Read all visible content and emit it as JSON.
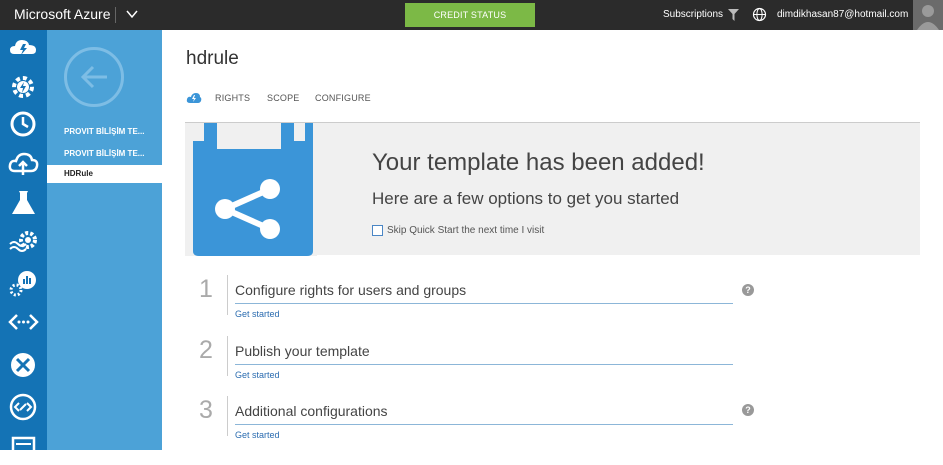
{
  "topbar": {
    "brand": "Microsoft Azure",
    "credit_status": "CREDIT STATUS",
    "subscriptions": "Subscriptions",
    "user_email": "dimdikhasan87@hotmail.com"
  },
  "rail": {
    "icons": [
      "cloud-services-icon",
      "gear-lightning-icon",
      "clock-icon",
      "cloud-upload-icon",
      "flask-icon",
      "gear-waves-icon",
      "chart-gear-icon",
      "code-brackets-icon",
      "tools-icon",
      "arrows-icon",
      "list-icon"
    ]
  },
  "subnav": {
    "items": [
      {
        "label": "PROVIT BİLİŞİM TE..."
      },
      {
        "label": "PROVIT BİLİŞİM TE..."
      },
      {
        "label": "HDRule"
      }
    ]
  },
  "main": {
    "title": "hdrule",
    "tabs": [
      {
        "label": "RIGHTS"
      },
      {
        "label": "SCOPE"
      },
      {
        "label": "CONFIGURE"
      }
    ],
    "banner": {
      "heading": "Your template has been added!",
      "subheading": "Here are a few options to get you started",
      "skip_label": "Skip Quick Start the next time I visit"
    },
    "steps": [
      {
        "number": "1",
        "title": "Configure rights for users and groups",
        "link": "Get started"
      },
      {
        "number": "2",
        "title": "Publish your template",
        "link": "Get started"
      },
      {
        "number": "3",
        "title": "Additional configurations",
        "link": "Get started"
      }
    ]
  },
  "colors": {
    "topbar": "#2b2b2b",
    "rail": "#1473b5",
    "subnav": "#4ca2d7",
    "credit": "#7cb946",
    "banner_graphic": "#3b95d8"
  }
}
